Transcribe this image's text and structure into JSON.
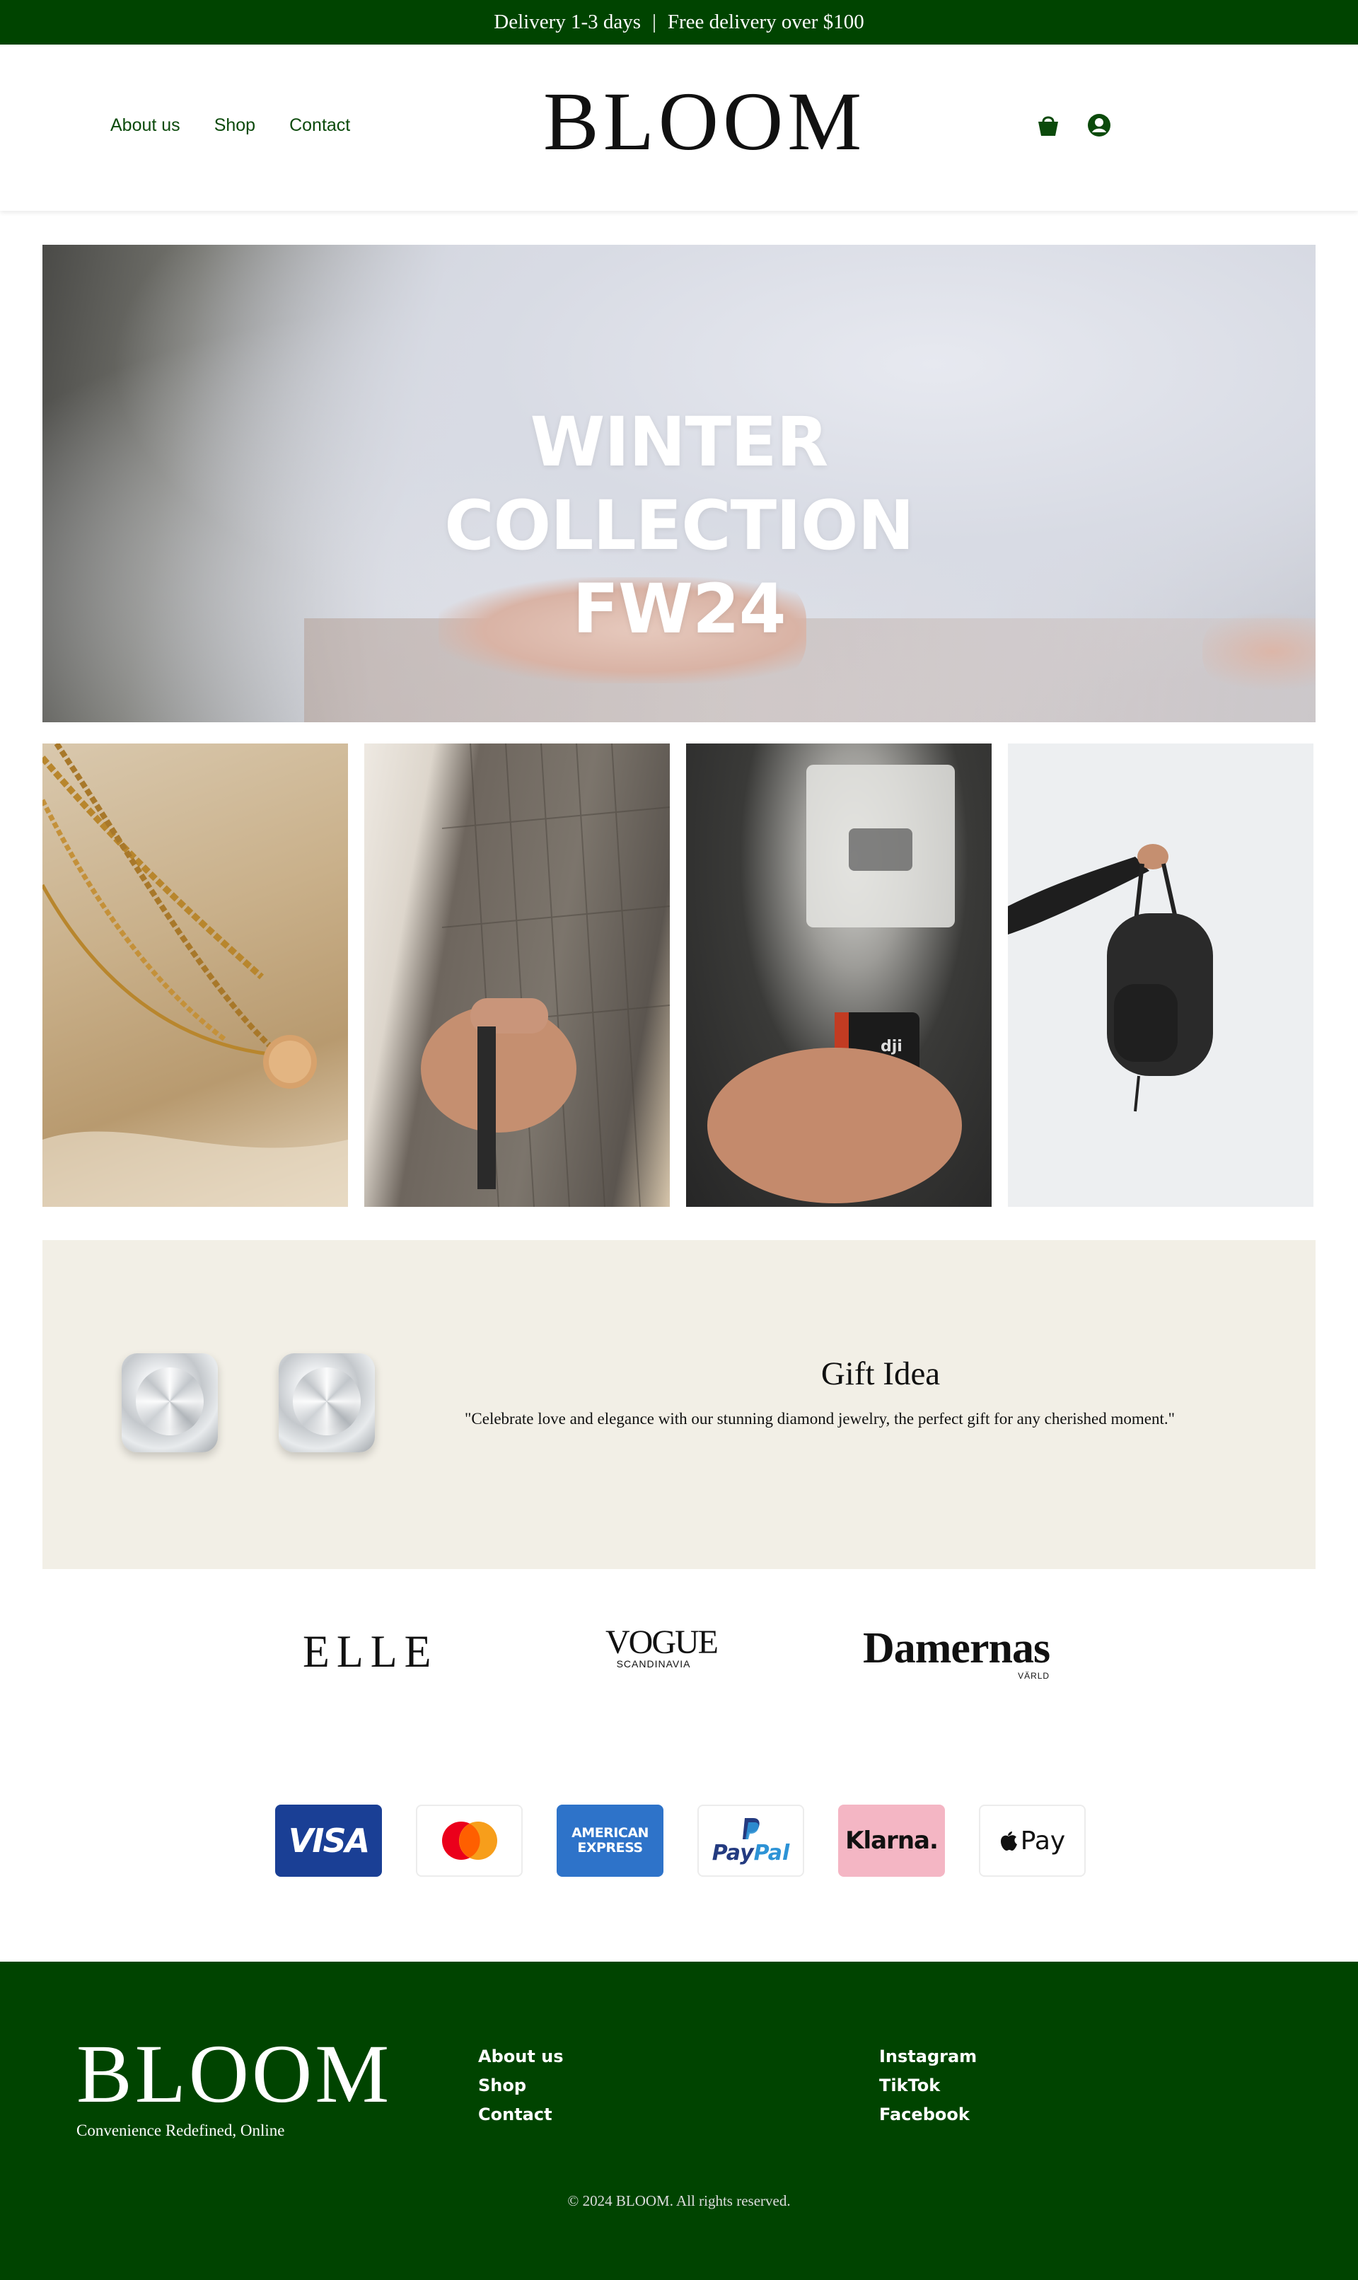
{
  "topbar": {
    "delivery": "Delivery 1-3 days",
    "separator": "|",
    "free_delivery": "Free delivery over $100"
  },
  "header": {
    "logo": "BLOOM",
    "nav": [
      "About us",
      "Shop",
      "Contact"
    ],
    "icons": [
      "basket-icon",
      "user-icon"
    ]
  },
  "hero": {
    "title_lines": [
      "WINTER",
      "COLLECTION",
      "FW24"
    ]
  },
  "products": [
    "gold-necklaces",
    "plaid-fabric",
    "dji-microphone",
    "black-backpack"
  ],
  "gift": {
    "title": "Gift Idea",
    "text": "\"Celebrate love and elegance with our stunning diamond jewelry, the perfect gift for any cherished moment.\""
  },
  "press": {
    "elle": "ELLE",
    "vogue": "VOGUE",
    "vogue_sub": "SCANDINAVIA",
    "damernas": "Damernas",
    "damernas_sub": "VÄRLD"
  },
  "payments": {
    "visa": "VISA",
    "amex_line1": "AMERICAN",
    "amex_line2": "EXPRESS",
    "paypal_pay": "Pay",
    "paypal_pal": "Pal",
    "klarna": "Klarna.",
    "applepay": "Pay"
  },
  "colors": {
    "brand_green": "#004400",
    "gift_bg": "#f2efe6",
    "nav_green": "#0b4a0b"
  },
  "footer": {
    "logo": "BLOOM",
    "tagline": "Convenience Redefined, Online",
    "links": [
      "About us",
      "Shop",
      "Contact"
    ],
    "social": [
      "Instagram",
      "TikTok",
      "Facebook"
    ],
    "copyright": "© 2024 BLOOM. All rights reserved."
  }
}
